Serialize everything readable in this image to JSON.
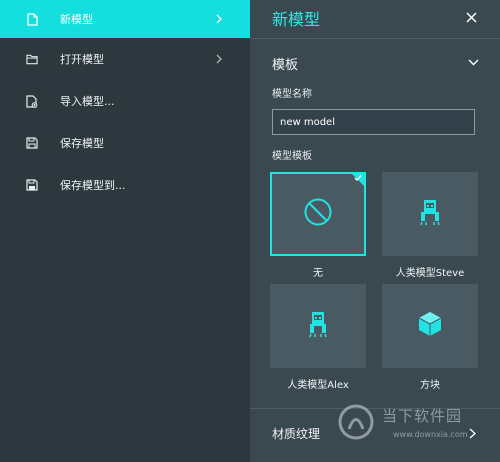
{
  "menu": {
    "items": [
      {
        "label": "新模型",
        "icon": "new-file-icon",
        "active": true,
        "has_submenu": true
      },
      {
        "label": "打开模型",
        "icon": "folder-icon",
        "active": false,
        "has_submenu": true
      },
      {
        "label": "导入模型...",
        "icon": "import-file-icon",
        "active": false,
        "has_submenu": false
      },
      {
        "label": "保存模型",
        "icon": "save-icon",
        "active": false,
        "has_submenu": false
      },
      {
        "label": "保存模型到...",
        "icon": "save-as-icon",
        "active": false,
        "has_submenu": false
      }
    ],
    "active_color": "#15dede"
  },
  "panel": {
    "title": "新模型",
    "close_icon": "close-icon",
    "section_title": "模板",
    "name_label": "模型名称",
    "name_value": "new model",
    "template_label": "模型模板",
    "templates": [
      {
        "label": "无",
        "icon": "none-icon",
        "selected": true
      },
      {
        "label": "人类模型Steve",
        "icon": "steve-model-icon",
        "selected": false
      },
      {
        "label": "人类模型Alex",
        "icon": "alex-model-icon",
        "selected": false
      },
      {
        "label": "方块",
        "icon": "cube-icon",
        "selected": false
      }
    ],
    "footer_label": "材质纹理",
    "accent_color": "#2ee8e8"
  },
  "watermark": {
    "text": "当下软件园",
    "url": "www.downxia.com"
  }
}
